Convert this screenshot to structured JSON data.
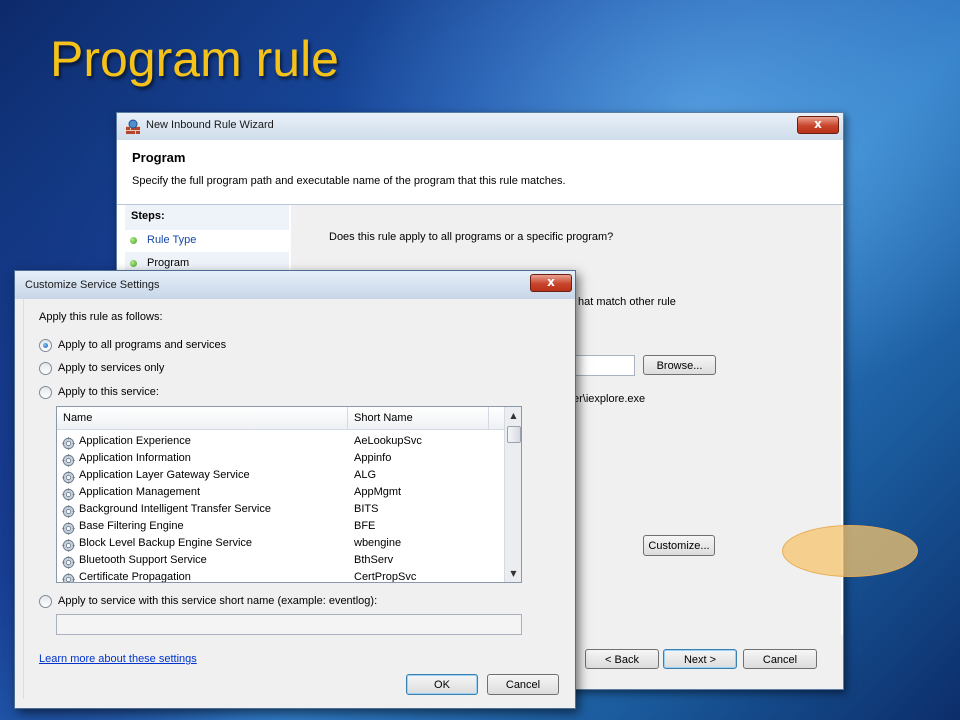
{
  "slide": {
    "title": "Program rule"
  },
  "wizard": {
    "window_title": "New Inbound Rule Wizard",
    "close_label": "x",
    "heading": "Program",
    "description": "Specify the full program path and executable name of the program that this rule matches.",
    "steps_heading": "Steps:",
    "steps": [
      {
        "label": "Rule Type"
      },
      {
        "label": "Program"
      }
    ],
    "question": "Does this rule apply to all programs or a specific program?",
    "partial_option_text": "hat match other rule",
    "partial_example_text": "er\\iexplore.exe",
    "browse_label": "Browse...",
    "customize_label": "Customize...",
    "back_label": "< Back",
    "next_label": "Next >",
    "cancel_label": "Cancel"
  },
  "customize": {
    "window_title": "Customize Service Settings",
    "close_label": "x",
    "apply_heading": "Apply this rule as follows:",
    "options": {
      "all": "Apply to all programs and services",
      "services_only": "Apply to services only",
      "this_service": "Apply to this service:",
      "short_name": "Apply to service with this service short name (example: eventlog):"
    },
    "selected_option": "all",
    "short_name_value": "",
    "columns": [
      "Name",
      "Short Name"
    ],
    "services": [
      {
        "name": "Application Experience",
        "short": "AeLookupSvc"
      },
      {
        "name": "Application Information",
        "short": "Appinfo"
      },
      {
        "name": "Application Layer Gateway Service",
        "short": "ALG"
      },
      {
        "name": "Application Management",
        "short": "AppMgmt"
      },
      {
        "name": "Background Intelligent Transfer Service",
        "short": "BITS"
      },
      {
        "name": "Base Filtering Engine",
        "short": "BFE"
      },
      {
        "name": "Block Level Backup Engine Service",
        "short": "wbengine"
      },
      {
        "name": "Bluetooth Support Service",
        "short": "BthServ"
      },
      {
        "name": "Certificate Propagation",
        "short": "CertPropSvc"
      }
    ],
    "learn_more": "Learn more about these settings",
    "ok_label": "OK",
    "cancel_label": "Cancel"
  }
}
